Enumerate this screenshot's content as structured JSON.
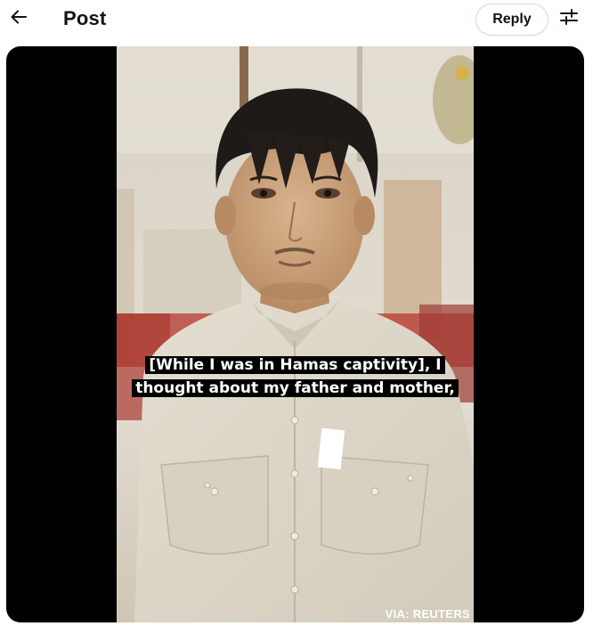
{
  "header": {
    "back_icon": "arrow-left-icon",
    "title": "Post",
    "reply_label": "Reply",
    "tune_icon": "sliders-icon"
  },
  "media": {
    "caption_line1": "[While I was in Hamas captivity], I",
    "caption_line2": "thought about my father and mother,",
    "credit": "VIA: REUTERS"
  }
}
